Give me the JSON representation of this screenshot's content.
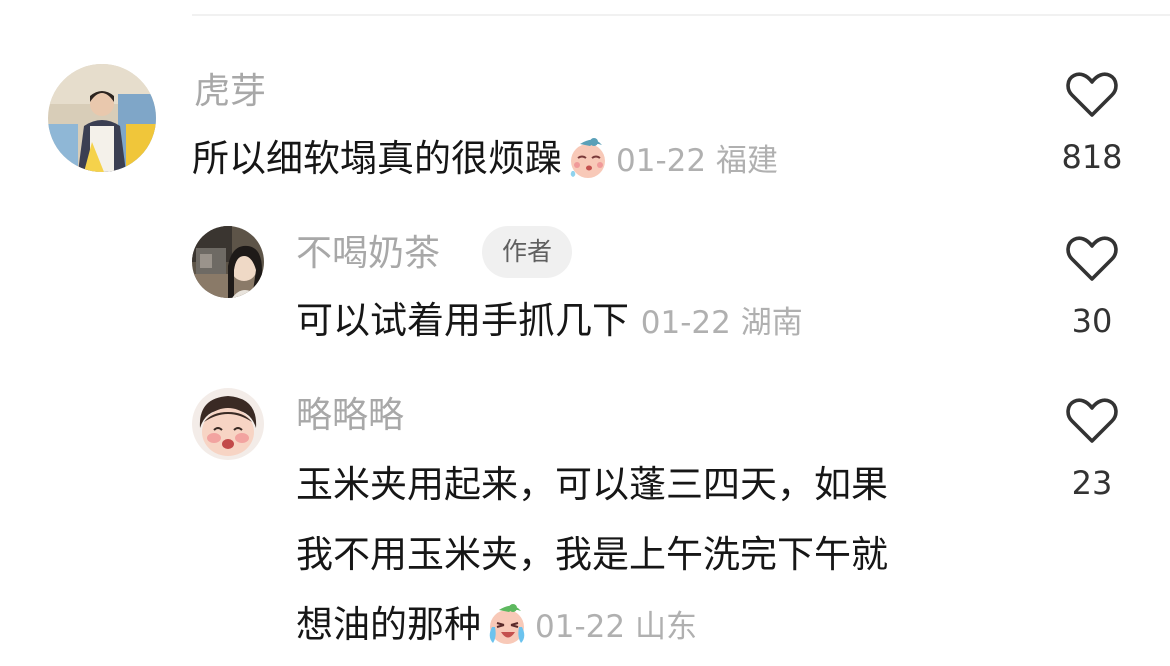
{
  "comments": [
    {
      "username": "虎芽",
      "text": "所以细软塌真的很烦躁",
      "date": "01-22",
      "location": "福建",
      "likes": "818",
      "emoji": "sad-sweat-emoji"
    },
    {
      "username": "不喝奶茶",
      "badge": "作者",
      "text": "可以试着用手抓几下",
      "date": "01-22",
      "location": "湖南",
      "likes": "30"
    },
    {
      "username": "略略略",
      "text_lines": [
        "玉米夹用起来，可以蓬三四天，如果",
        "我不用玉米夹，我是上午洗完下午就",
        "想油的那种"
      ],
      "date": "01-22",
      "location": "山东",
      "likes": "23",
      "emoji": "crying-emoji"
    }
  ],
  "colors": {
    "username": "#a8a8a8",
    "text": "#161616",
    "meta": "#b0b0b0",
    "heart": "#333333"
  },
  "icons": {
    "like": "heart-outline-icon"
  }
}
